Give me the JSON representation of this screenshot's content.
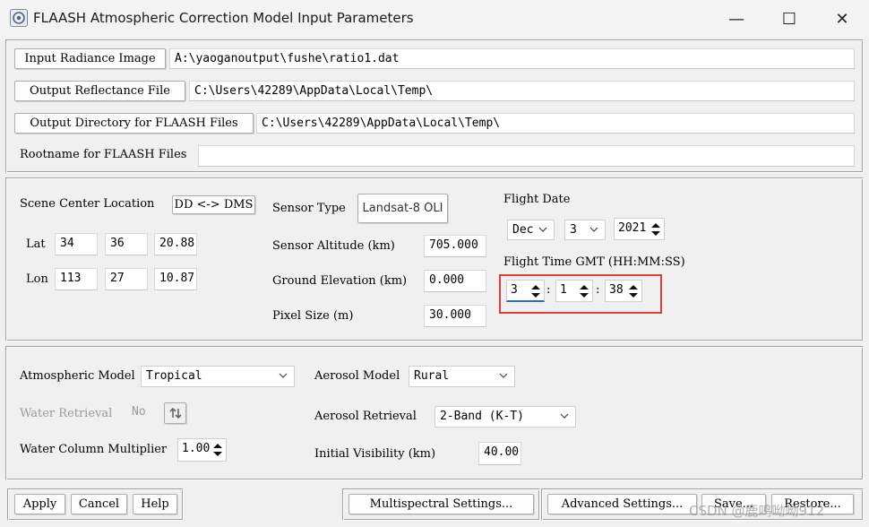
{
  "window": {
    "title": "FLAASH Atmospheric Correction Model Input Parameters",
    "minimize": "—",
    "maximize": "☐",
    "close": "✕"
  },
  "files": {
    "input_radiance_label": "Input Radiance Image",
    "input_radiance_value": "A:\\yaoganoutput\\fushe\\ratio1.dat",
    "output_reflectance_label": "Output Reflectance File",
    "output_reflectance_value": "C:\\Users\\42289\\AppData\\Local\\Temp\\",
    "output_directory_label": "Output Directory for FLAASH Files",
    "output_directory_value": "C:\\Users\\42289\\AppData\\Local\\Temp\\",
    "rootname_label": "Rootname for FLAASH Files",
    "rootname_value": ""
  },
  "scene": {
    "location_label": "Scene Center Location",
    "dd_dms_button": "DD <-> DMS",
    "lat_label": "Lat",
    "lat": [
      "34",
      "36",
      "20.88"
    ],
    "lon_label": "Lon",
    "lon": [
      "113",
      "27",
      "10.87"
    ]
  },
  "sensor": {
    "type_label": "Sensor Type",
    "type_value": "Landsat-8 OLI",
    "altitude_label": "Sensor Altitude (km)",
    "altitude_value": "705.000",
    "ground_label": "Ground Elevation (km)",
    "ground_value": "0.000",
    "pixel_label": "Pixel Size (m)",
    "pixel_value": "30.000"
  },
  "flight": {
    "date_label": "Flight Date",
    "month": "Dec",
    "day": "3",
    "year": "2021",
    "time_label": "Flight Time GMT (HH:MM:SS)",
    "hh": "3",
    "mm": "1",
    "ss": "38",
    "sep": ":",
    "highlight_color": "#e03c3c"
  },
  "atmosphere": {
    "model_label": "Atmospheric Model",
    "model_value": "Tropical",
    "water_retrieval_label": "Water Retrieval",
    "water_retrieval_value": "No",
    "water_multiplier_label": "Water Column Multiplier",
    "water_multiplier_value": "1.00",
    "aerosol_model_label": "Aerosol Model",
    "aerosol_model_value": "Rural",
    "aerosol_retrieval_label": "Aerosol Retrieval",
    "aerosol_retrieval_value": "2-Band (K-T)",
    "visibility_label": "Initial Visibility (km)",
    "visibility_value": "40.00"
  },
  "buttons": {
    "apply": "Apply",
    "cancel": "Cancel",
    "help": "Help",
    "multispectral": "Multispectral Settings...",
    "advanced": "Advanced Settings...",
    "save": "Save...",
    "restore": "Restore..."
  },
  "watermark": "CSDN @鹿鸣呦呦912"
}
